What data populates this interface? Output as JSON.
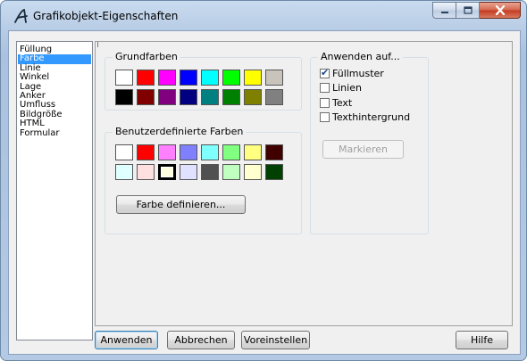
{
  "window": {
    "title": "Grafikobjekt-Eigenschaften",
    "app_icon": "script-a-icon",
    "controls": {
      "minimize": "minimize-icon",
      "maximize": "maximize-icon",
      "close": "close-icon"
    }
  },
  "nav": {
    "items": [
      {
        "label": "Füllung",
        "selected": false
      },
      {
        "label": "Farbe",
        "selected": true
      },
      {
        "label": "Linie",
        "selected": false
      },
      {
        "label": "Winkel",
        "selected": false
      },
      {
        "label": "Lage",
        "selected": false
      },
      {
        "label": "Anker",
        "selected": false
      },
      {
        "label": "Umfluss",
        "selected": false
      },
      {
        "label": "Bildgröße",
        "selected": false
      },
      {
        "label": "HTML",
        "selected": false
      },
      {
        "label": "Formular",
        "selected": false
      }
    ]
  },
  "basic_colors": {
    "label": "Grundfarben",
    "colors": [
      "#ffffff",
      "#ff0000",
      "#ff00ff",
      "#0000ff",
      "#00ffff",
      "#00ff00",
      "#ffff00",
      "#c8c4bc",
      "#000000",
      "#800000",
      "#800080",
      "#000080",
      "#008080",
      "#008000",
      "#808000",
      "#808080"
    ]
  },
  "custom_colors": {
    "label": "Benutzerdefinierte Farben",
    "colors": [
      "#ffffff",
      "#ff0000",
      "#ff80ff",
      "#8080ff",
      "#80ffff",
      "#80ff80",
      "#ffff80",
      "#400000",
      "#e0ffff",
      "#ffe0e0",
      "#ffffe0",
      "#e0e0ff",
      "#505050",
      "#c0ffc0",
      "#ffffd0",
      "#004000"
    ],
    "selected_index": 10,
    "define_button": "Farbe definieren..."
  },
  "apply_to": {
    "label": "Anwenden auf...",
    "options": [
      {
        "label": "Füllmuster",
        "checked": true
      },
      {
        "label": "Linien",
        "checked": false
      },
      {
        "label": "Text",
        "checked": false
      },
      {
        "label": "Texthintergrund",
        "checked": false
      }
    ],
    "mark_button": "Markieren"
  },
  "footer": {
    "apply": "Anwenden",
    "cancel": "Abbrechen",
    "preset": "Voreinstellen",
    "help": "Hilfe"
  }
}
